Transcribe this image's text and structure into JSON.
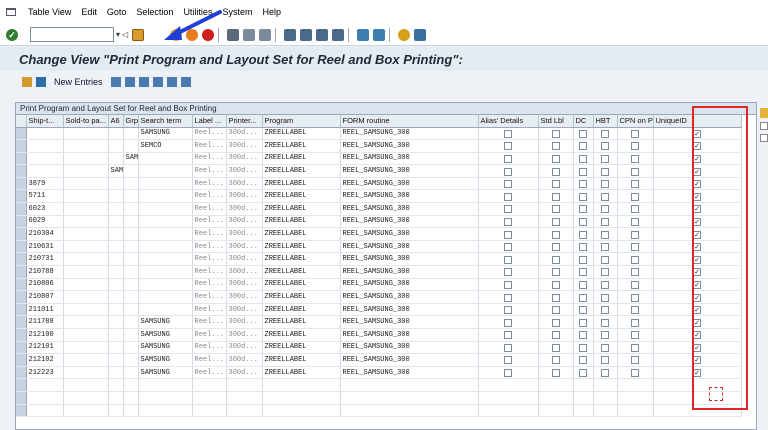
{
  "menu": [
    "Table View",
    "Edit",
    "Goto",
    "Selection",
    "Utilities",
    "System",
    "Help"
  ],
  "title": "Change View \"Print Program and Layout Set for Reel and Box Printing\":",
  "app_toolbar": {
    "new_entries": "New Entries"
  },
  "table": {
    "title": "Print Program and Layout Set for Reel and Box Printing",
    "columns": [
      "",
      "Ship-t...",
      "Sold-to pa...",
      "A6",
      "Grp5",
      "Search term",
      "Label ...",
      "Printer...",
      "Program",
      "FORM routine",
      "Alias' Details",
      "Std Lbl",
      "DC",
      "HBT",
      "CPN on PL",
      "UniqueID"
    ],
    "rows": [
      {
        "ship": "",
        "sold": "",
        "a6": "",
        "grp5": "",
        "search": "SAMSUNG"
      },
      {
        "ship": "",
        "sold": "",
        "a6": "",
        "grp5": "",
        "search": "SEMCO"
      },
      {
        "ship": "",
        "sold": "",
        "a6": "",
        "grp5": "SAM",
        "search": ""
      },
      {
        "ship": "",
        "sold": "",
        "a6": "SAM",
        "grp5": "",
        "search": ""
      },
      {
        "ship": "3879",
        "sold": "",
        "a6": "",
        "grp5": "",
        "search": ""
      },
      {
        "ship": "5711",
        "sold": "",
        "a6": "",
        "grp5": "",
        "search": ""
      },
      {
        "ship": "6023",
        "sold": "",
        "a6": "",
        "grp5": "",
        "search": ""
      },
      {
        "ship": "6029",
        "sold": "",
        "a6": "",
        "grp5": "",
        "search": ""
      },
      {
        "ship": "210304",
        "sold": "",
        "a6": "",
        "grp5": "",
        "search": ""
      },
      {
        "ship": "210631",
        "sold": "",
        "a6": "",
        "grp5": "",
        "search": ""
      },
      {
        "ship": "210731",
        "sold": "",
        "a6": "",
        "grp5": "",
        "search": ""
      },
      {
        "ship": "210788",
        "sold": "",
        "a6": "",
        "grp5": "",
        "search": ""
      },
      {
        "ship": "210806",
        "sold": "",
        "a6": "",
        "grp5": "",
        "search": ""
      },
      {
        "ship": "210807",
        "sold": "",
        "a6": "",
        "grp5": "",
        "search": ""
      },
      {
        "ship": "211011",
        "sold": "",
        "a6": "",
        "grp5": "",
        "search": ""
      },
      {
        "ship": "211788",
        "sold": "",
        "a6": "",
        "grp5": "",
        "search": "SAMSUNG"
      },
      {
        "ship": "212100",
        "sold": "",
        "a6": "",
        "grp5": "",
        "search": "SAMSUNG"
      },
      {
        "ship": "212101",
        "sold": "",
        "a6": "",
        "grp5": "",
        "search": "SAMSUNG"
      },
      {
        "ship": "212102",
        "sold": "",
        "a6": "",
        "grp5": "",
        "search": "SAMSUNG"
      },
      {
        "ship": "212223",
        "sold": "",
        "a6": "",
        "grp5": "",
        "search": "SAMSUNG"
      }
    ],
    "label_value": "Reel...",
    "printer_value": "300d...",
    "program_value": "ZREELLABEL",
    "form_value": "REEL_SAMSUNG_300",
    "empty_rows": 3
  }
}
